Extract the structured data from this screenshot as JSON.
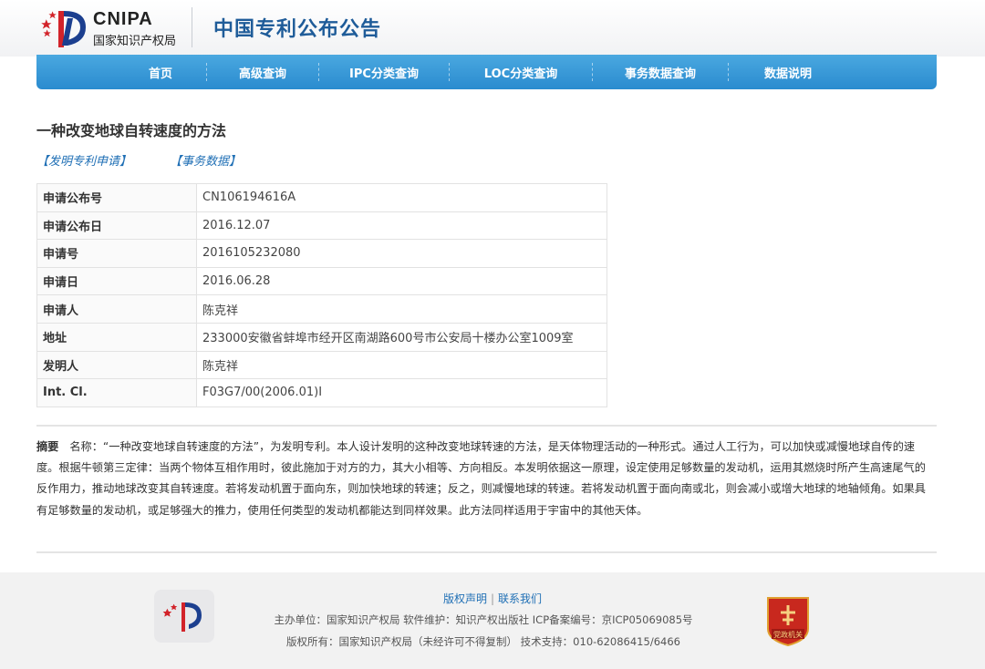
{
  "header": {
    "logo_text": "CNIPA",
    "logo_subtitle": "国家知识产权局",
    "site_title": "中国专利公布公告"
  },
  "nav": {
    "items": [
      "首页",
      "高级查询",
      "IPC分类查询",
      "LOC分类查询",
      "事务数据查询",
      "数据说明"
    ]
  },
  "patent": {
    "title": "一种改变地球自转速度的方法",
    "type_link": "【发明专利申请】",
    "data_link": "【事务数据】",
    "fields": [
      {
        "label": "申请公布号",
        "value": "CN106194616A"
      },
      {
        "label": "申请公布日",
        "value": "2016.12.07"
      },
      {
        "label": "申请号",
        "value": "2016105232080"
      },
      {
        "label": "申请日",
        "value": "2016.06.28"
      },
      {
        "label": "申请人",
        "value": "陈克祥"
      },
      {
        "label": "地址",
        "value": "233000安徽省蚌埠市经开区南湖路600号市公安局十楼办公室1009室"
      },
      {
        "label": "发明人",
        "value": "陈克祥"
      },
      {
        "label": "Int. Cl.",
        "value": "F03G7/00(2006.01)I"
      }
    ],
    "abstract_label": "摘要",
    "abstract_text": "名称：“一种改变地球自转速度的方法”，为发明专利。本人设计发明的这种改变地球转速的方法，是天体物理活动的一种形式。通过人工行为，可以加快或减慢地球自传的速度。根据牛顿第三定律：当两个物体互相作用时，彼此施加于对方的力，其大小相等、方向相反。本发明依据这一原理，设定使用足够数量的发动机，运用其燃烧时所产生高速尾气的反作用力，推动地球改变其自转速度。若将发动机置于面向东，则加快地球的转速；反之，则减慢地球的转速。若将发动机置于面向南或北，则会减小或增大地球的地轴倾角。如果具有足够数量的发动机，或足够强大的推力，使用任何类型的发动机都能达到同样效果。此方法同样适用于宇宙中的其他天体。"
  },
  "footer": {
    "copyright_link": "版权声明",
    "contact_link": "联系我们",
    "host_line": "主办单位：国家知识产权局    软件维护：知识产权出版社    ICP备案编号：京ICP05069085号",
    "rights_line": "版权所有：国家知识产权局（未经许可不得复制）    技术支持：010-62086415/6466",
    "badge_text": "党政机关"
  },
  "colors": {
    "nav_blue": "#2a8bcf",
    "title_blue": "#1f5c99",
    "link_blue": "#1f6fb5",
    "logo_red": "#d2232a"
  }
}
